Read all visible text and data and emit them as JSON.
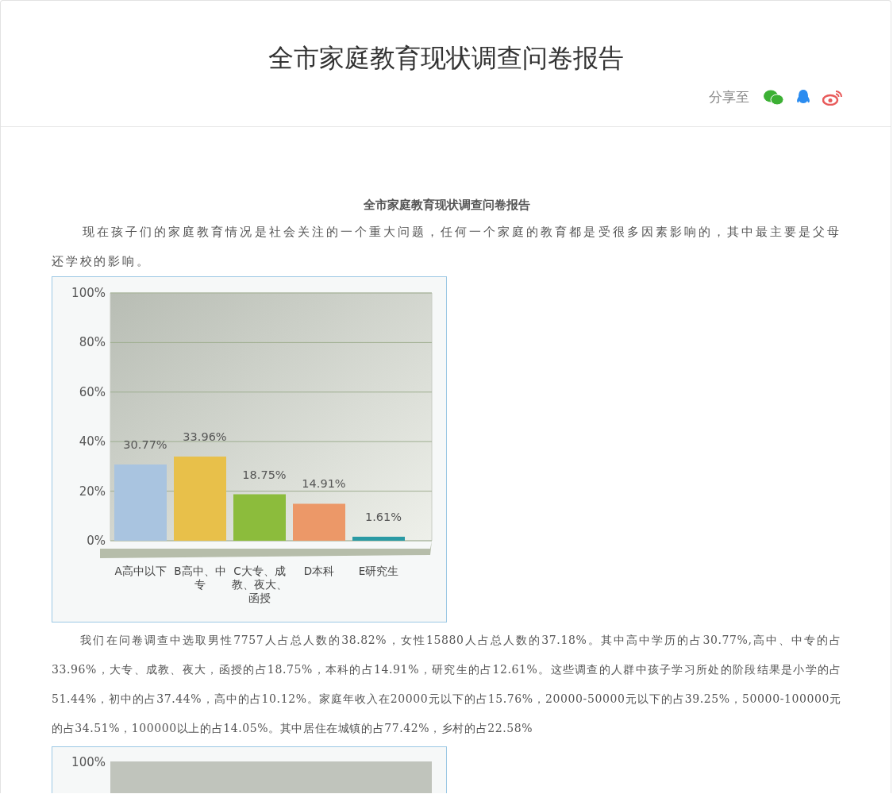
{
  "header": {
    "title": "全市家庭教育现状调查问卷报告",
    "share_label": "分享至"
  },
  "article": {
    "heading": "全市家庭教育现状调查问卷报告",
    "intro": "现在孩子们的家庭教育情况是社会关注的一个重大问题，任何一个家庭的教育都是受很多因素影响的，其中最主要是父母还学校的影响。",
    "chart_data": {
      "type": "bar",
      "categories": [
        "A高中以下",
        "B高中、中专",
        "C大专、成教、夜大、函授",
        "D本科",
        "E研究生"
      ],
      "values": [
        30.77,
        33.96,
        18.75,
        14.91,
        1.61
      ],
      "grid": true,
      "ylim": [
        0,
        100
      ],
      "yticks": [
        {
          "value": 0,
          "label": "0%"
        },
        {
          "value": 20,
          "label": "20%"
        },
        {
          "value": 40,
          "label": "40%"
        },
        {
          "value": 60,
          "label": "60%"
        },
        {
          "value": 80,
          "label": "80%"
        },
        {
          "value": 100,
          "label": "100%"
        }
      ],
      "value_labels": [
        "30.77%",
        "33.96%",
        "18.75%",
        "14.91%",
        "1.61%"
      ]
    },
    "body": "我们在问卷调查中选取男性7757人占总人数的38.82%，女性15880人占总人数的37.18%。其中高中学历的占30.77%,高中、中专的占33.96%，大专、成教、夜大，函授的占18.75%，本科的占14.91%，研究生的占12.61%。这些调查的人群中孩子学习所处的阶段结果是小学的占51.44%，初中的占37.44%，高中的占10.12%。家庭年收入在20000元以下的占15.76%，20000-50000元以下的占39.25%，50000-100000元的占34.51%，100000以上的占14.05%。其中居住在城镇的占77.42%，乡村的占22.58%",
    "second_chart": {
      "top_tick": "100%"
    }
  }
}
